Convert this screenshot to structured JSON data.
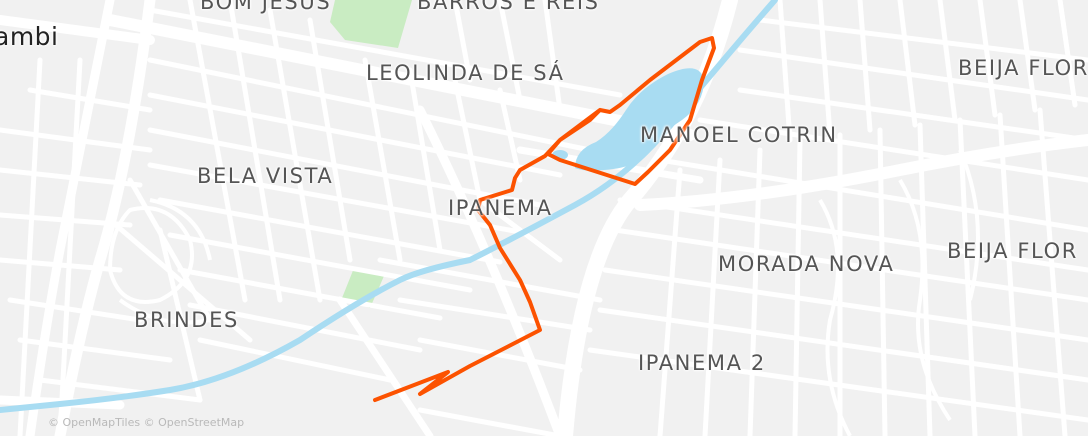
{
  "map": {
    "labels": {
      "bom_jesus": "BOM JESUS",
      "barros_e_reis": "BARROS E REIS",
      "city_partial": "ambi",
      "leolinda_de_sa": "LEOLINDA DE SÁ",
      "beija_flor_1": "BEIJA FLOR",
      "manoel_cotrin": "MANOEL COTRIN",
      "bela_vista": "BELA VISTA",
      "ipanema": "IPANEMA",
      "beija_flor_2": "BEIJA FLOR",
      "morada_nova": "MORADA NOVA",
      "brindes": "BRINDES",
      "ipanema_2": "IPANEMA 2"
    },
    "attribution": "© OpenMapTiles © OpenStreetMap"
  },
  "colors": {
    "background": "#f1f1f1",
    "street": "#ffffff",
    "major_road": "#ffffff",
    "water": "#a8dcf2",
    "park": "#c9ecc2",
    "route": "#fc5200"
  }
}
